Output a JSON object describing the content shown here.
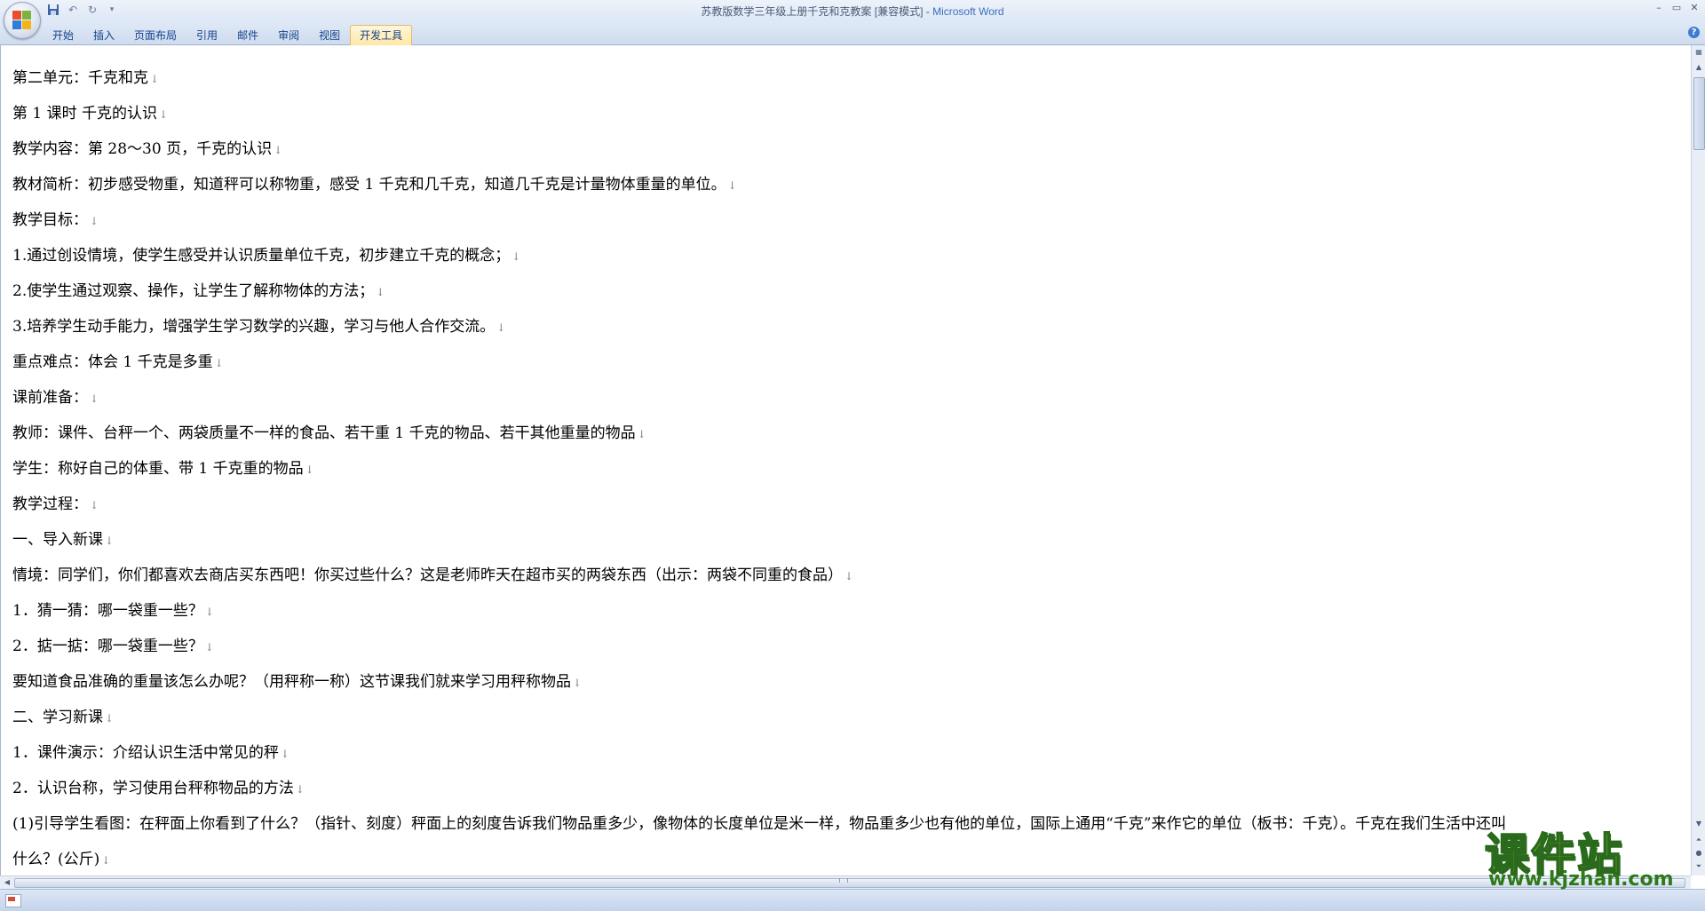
{
  "window": {
    "title": "苏教版数学三年级上册千克和克教案 [兼容模式] - ",
    "app_name": "Microsoft Word",
    "controls": [
      "–",
      "▭",
      "✕"
    ]
  },
  "ribbon": {
    "tabs": [
      {
        "label": "开始"
      },
      {
        "label": "插入"
      },
      {
        "label": "页面布局"
      },
      {
        "label": "引用"
      },
      {
        "label": "邮件"
      },
      {
        "label": "审阅"
      },
      {
        "label": "视图"
      },
      {
        "label": "开发工具",
        "active": true
      }
    ]
  },
  "document": {
    "paragraph_mark": "↓",
    "lines": [
      "第二单元：千克和克",
      "第 1 课时  千克的认识",
      "教学内容：第 28～30 页，千克的认识",
      "教材简析：初步感受物重，知道秤可以称物重，感受 1 千克和几千克，知道几千克是计量物体重量的单位。",
      "教学目标：",
      "1.通过创设情境，使学生感受并认识质量单位千克，初步建立千克的概念；",
      "2.使学生通过观察、操作，让学生了解称物体的方法；",
      "3.培养学生动手能力，增强学生学习数学的兴趣，学习与他人合作交流。",
      "重点难点：体会 1 千克是多重",
      "课前准备：",
      "教师：课件、台秤一个、两袋质量不一样的食品、若干重 1 千克的物品、若干其他重量的物品",
      "学生：称好自己的体重、带 1 千克重的物品",
      "教学过程：",
      "一、导入新课",
      "情境：同学们，你们都喜欢去商店买东西吧！你买过些什么？这是老师昨天在超市买的两袋东西（出示：两袋不同重的食品）",
      "1．猜一猜：哪一袋重一些？",
      "2．掂一掂：哪一袋重一些？",
      "要知道食品准确的重量该怎么办呢？（用秤称一称）这节课我们就来学习用秤称物品",
      "二、学习新课",
      "1．课件演示：介绍认识生活中常见的秤",
      "2．认识台称，学习使用台秤称物品的方法",
      "(1)引导学生看图：在秤面上你看到了什么？（指针、刻度）秤面上的刻度告诉我们物品重多少，像物体的长度单位是米一样，物品重多少也有他的单位，国际上通用“千克”来作它的单位（板书：千克）。千克在我们生活中还叫",
      "什么？(公斤)"
    ]
  },
  "watermark": {
    "text": "课件站",
    "url": "www.kjzhan.com"
  }
}
